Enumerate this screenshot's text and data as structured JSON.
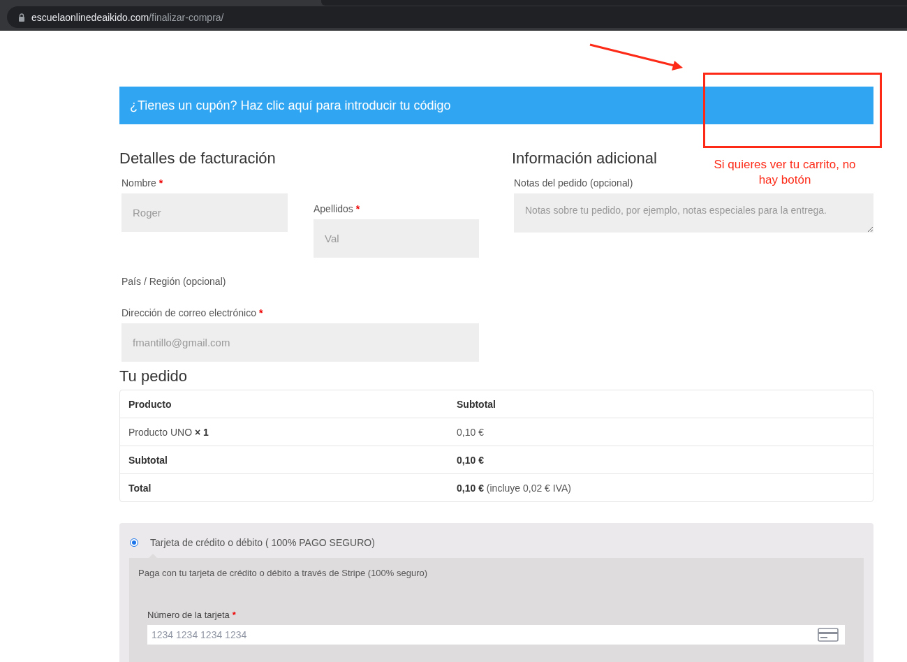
{
  "browser": {
    "url_host": "escuelaonlinedeaikido.com",
    "url_path": "/finalizar-compra/"
  },
  "coupon_notice": "¿Tienes un cupón? Haz clic aquí para introducir tu código",
  "billing": {
    "title": "Detalles de facturación",
    "fields": [
      {
        "kind": "input",
        "label": "Nombre",
        "required_mark": "*",
        "placeholder": "Roger"
      },
      {
        "kind": "input",
        "label": "Apellidos",
        "required_mark": "*",
        "placeholder": "Val"
      },
      {
        "kind": "label",
        "label": "País / Región (opcional)"
      },
      {
        "kind": "input",
        "label": "Dirección de correo electrónico",
        "required_mark": "*",
        "placeholder": "fmantillo@gmail.com"
      }
    ]
  },
  "additional": {
    "title": "Información adicional",
    "notes_label": "Notas del pedido (opcional)",
    "notes_placeholder": "Notas sobre tu pedido, por ejemplo, notas especiales para la entrega."
  },
  "order": {
    "title": "Tu pedido",
    "columns": [
      "Producto",
      "Subtotal"
    ],
    "rows": [
      {
        "kind": "item",
        "label": "Producto UNO  **× 1**",
        "value": "0,10 €"
      },
      {
        "kind": "subtotal",
        "label": "Subtotal",
        "value": "0,10 €"
      },
      {
        "kind": "total",
        "label": "Total",
        "value": "**0,10 €** (incluye 0,02 € IVA)"
      }
    ]
  },
  "payment": {
    "methods": [
      {
        "label": "Tarjeta de crédito o débito ( 100% PAGO SEGURO)",
        "selected": true,
        "description": "Paga con tu tarjeta de crédito o débito a través de Stripe (100% seguro)",
        "card_label": "Número de la tarjeta",
        "card_required_mark": "*",
        "card_placeholder": "1234 1234 1234 1234"
      }
    ]
  },
  "annotations": [
    {
      "kind": "arrow"
    },
    {
      "kind": "box"
    },
    {
      "kind": "note",
      "text": "Si quieres ver tu carrito, no hay botón"
    }
  ]
}
